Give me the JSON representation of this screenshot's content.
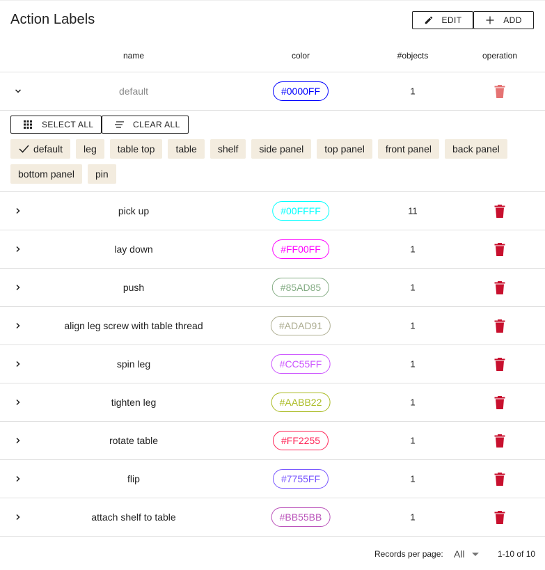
{
  "title": "Action Labels",
  "toolbar": {
    "edit_label": "EDIT",
    "add_label": "ADD"
  },
  "columns": {
    "name": "name",
    "color": "color",
    "objects": "#objects",
    "operation": "operation"
  },
  "expanded_row": {
    "name": "default",
    "color": "#0000FF",
    "count": "1",
    "select_all_label": "SELECT ALL",
    "clear_all_label": "CLEAR ALL",
    "objects": [
      {
        "label": "default",
        "selected": true
      },
      {
        "label": "leg",
        "selected": false
      },
      {
        "label": "table top",
        "selected": false
      },
      {
        "label": "table",
        "selected": false
      },
      {
        "label": "shelf",
        "selected": false
      },
      {
        "label": "side panel",
        "selected": false
      },
      {
        "label": "top panel",
        "selected": false
      },
      {
        "label": "front panel",
        "selected": false
      },
      {
        "label": "back panel",
        "selected": false
      },
      {
        "label": "bottom panel",
        "selected": false
      },
      {
        "label": "pin",
        "selected": false
      }
    ]
  },
  "rows": [
    {
      "name": "pick up",
      "color": "#00FFFF",
      "count": "11"
    },
    {
      "name": "lay down",
      "color": "#FF00FF",
      "count": "1"
    },
    {
      "name": "push",
      "color": "#85AD85",
      "count": "1"
    },
    {
      "name": "align leg screw with table thread",
      "color": "#ADAD91",
      "count": "1"
    },
    {
      "name": "spin leg",
      "color": "#CC55FF",
      "count": "1"
    },
    {
      "name": "tighten leg",
      "color": "#AABB22",
      "count": "1"
    },
    {
      "name": "rotate table",
      "color": "#FF2255",
      "count": "1"
    },
    {
      "name": "flip",
      "color": "#7755FF",
      "count": "1"
    },
    {
      "name": "attach shelf to table",
      "color": "#BB55BB",
      "count": "1"
    }
  ],
  "footer": {
    "records_label": "Records per page:",
    "records_value": "All",
    "range": "1-10 of 10"
  },
  "colors": {
    "delete_active": "#c8102e",
    "delete_disabled": "#e57373",
    "tag_bg": "#f3ecdf",
    "divider": "#e0e0e0"
  },
  "icons": {
    "edit": "pencil-icon",
    "add": "plus-icon",
    "select_all": "grid-icon",
    "clear_all": "clear-list-icon",
    "expand": "chevron-icon",
    "delete": "trash-icon",
    "check": "check-icon",
    "dropdown": "caret-down-icon"
  }
}
